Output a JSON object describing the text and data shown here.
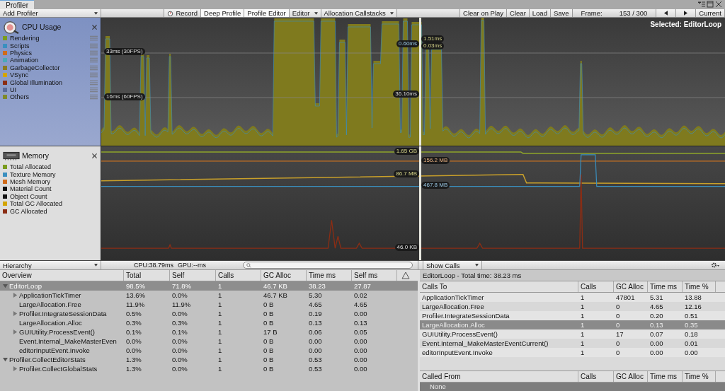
{
  "window": {
    "title": "Profiler"
  },
  "toolbar": {
    "add_profiler": "Add Profiler",
    "buttons": [
      {
        "label": "Record",
        "kind": "record"
      },
      {
        "label": "Deep Profile",
        "kind": "toggle"
      },
      {
        "label": "Profile Editor",
        "kind": "toggle"
      },
      {
        "label": "Editor",
        "kind": "dropdown"
      },
      {
        "label": "Allocation Callstacks",
        "kind": "dropdown"
      }
    ],
    "right_buttons": [
      "Clear on Play",
      "Clear",
      "Load",
      "Save"
    ],
    "frame_label": "Frame:",
    "frame_value": "153 / 300",
    "current": "Current"
  },
  "cpu": {
    "title": "CPU Usage",
    "legend": [
      {
        "name": "Rendering",
        "color": "#7a9c1e"
      },
      {
        "name": "Scripts",
        "color": "#3a8fbf"
      },
      {
        "name": "Physics",
        "color": "#d06b1a"
      },
      {
        "name": "Animation",
        "color": "#4aa8b8"
      },
      {
        "name": "GarbageCollector",
        "color": "#8b7a20"
      },
      {
        "name": "VSync",
        "color": "#d3a400"
      },
      {
        "name": "Global Illumination",
        "color": "#8b2d14"
      },
      {
        "name": "UI",
        "color": "#5a6a9a"
      },
      {
        "name": "Others",
        "color": "#7f8a2a"
      }
    ],
    "fps_lines": [
      "33ms (30FPS)",
      "16ms (60FPS)"
    ],
    "readings": [
      "1.51ms",
      "0.60ms",
      "0.03ms",
      "36.10ms"
    ],
    "selected": "Selected: EditorLoop"
  },
  "memory": {
    "title": "Memory",
    "legend": [
      {
        "name": "Total Allocated",
        "color": "#7a9c1e"
      },
      {
        "name": "Texture Memory",
        "color": "#3a8fbf"
      },
      {
        "name": "Mesh Memory",
        "color": "#d06b1a"
      },
      {
        "name": "Material Count",
        "color": "#111111"
      },
      {
        "name": "Object Count",
        "color": "#111111"
      },
      {
        "name": "Total GC Allocated",
        "color": "#d3a400"
      },
      {
        "name": "GC Allocated",
        "color": "#8b2d14"
      }
    ],
    "readings": [
      "1.65 GB",
      "156.2 MB",
      "86.7 MB",
      "467.8 MB",
      "46.0 KB"
    ]
  },
  "detail_bar": {
    "view": "Hierarchy",
    "cpu": "CPU:38.79ms",
    "gpu": "GPU:--ms",
    "calls_view": "Show Calls"
  },
  "overview": {
    "columns": [
      "Overview",
      "Total",
      "Self",
      "Calls",
      "GC Alloc",
      "Time ms",
      "Self ms"
    ],
    "rows": [
      {
        "cells": [
          "EditorLoop",
          "98.5%",
          "71.8%",
          "1",
          "46.7 KB",
          "38.23",
          "27.87"
        ],
        "expanded": true,
        "selected": true,
        "children": [
          {
            "cells": [
              "ApplicationTickTimer",
              "13.6%",
              "0.0%",
              "1",
              "46.7 KB",
              "5.30",
              "0.02"
            ],
            "expanded": false,
            "selected": false
          },
          {
            "cells": [
              "LargeAllocation.Free",
              "11.9%",
              "11.9%",
              "1",
              "0 B",
              "4.65",
              "4.65"
            ],
            "selected": false
          },
          {
            "cells": [
              "Profiler.IntegrateSessionData",
              "0.5%",
              "0.0%",
              "1",
              "0 B",
              "0.19",
              "0.00"
            ],
            "expanded": false,
            "selected": false
          },
          {
            "cells": [
              "LargeAllocation.Alloc",
              "0.3%",
              "0.3%",
              "1",
              "0 B",
              "0.13",
              "0.13"
            ],
            "selected": false
          },
          {
            "cells": [
              "GUIUtility.ProcessEvent()",
              "0.1%",
              "0.1%",
              "1",
              "17 B",
              "0.06",
              "0.05"
            ],
            "expanded": false,
            "selected": false
          },
          {
            "cells": [
              "Event.Internal_MakeMasterEven",
              "0.0%",
              "0.0%",
              "1",
              "0 B",
              "0.00",
              "0.00"
            ],
            "selected": false
          },
          {
            "cells": [
              "editorInputEvent.Invoke",
              "0.0%",
              "0.0%",
              "1",
              "0 B",
              "0.00",
              "0.00"
            ],
            "selected": false
          }
        ]
      },
      {
        "cells": [
          "Profiler.CollectEditorStats",
          "1.3%",
          "0.0%",
          "1",
          "0 B",
          "0.53",
          "0.00"
        ],
        "expanded": true,
        "selected": false,
        "children": [
          {
            "cells": [
              "Profiler.CollectGlobalStats",
              "1.3%",
              "0.0%",
              "1",
              "0 B",
              "0.53",
              "0.00"
            ],
            "expanded": false,
            "selected": false
          }
        ]
      }
    ]
  },
  "calls": {
    "title": "EditorLoop - Total time: 38.23 ms",
    "columns": [
      "Calls To",
      "Calls",
      "GC Alloc",
      "Time ms",
      "Time %"
    ],
    "rows": [
      {
        "cells": [
          "ApplicationTickTimer",
          "1",
          "47801",
          "5.31",
          "13.88"
        ],
        "selected": false
      },
      {
        "cells": [
          "LargeAllocation.Free",
          "1",
          "0",
          "4.65",
          "12.16"
        ],
        "selected": false
      },
      {
        "cells": [
          "Profiler.IntegrateSessionData",
          "1",
          "0",
          "0.20",
          "0.51"
        ],
        "selected": false
      },
      {
        "cells": [
          "LargeAllocation.Alloc",
          "1",
          "0",
          "0.13",
          "0.35"
        ],
        "selected": true
      },
      {
        "cells": [
          "GUIUtility.ProcessEvent()",
          "1",
          "17",
          "0.07",
          "0.18"
        ],
        "selected": false
      },
      {
        "cells": [
          "Event.Internal_MakeMasterEventCurrent()",
          "1",
          "0",
          "0.00",
          "0.01"
        ],
        "selected": false
      },
      {
        "cells": [
          "editorInputEvent.Invoke",
          "1",
          "0",
          "0.00",
          "0.00"
        ],
        "selected": false
      }
    ],
    "from_columns": [
      "Called From",
      "Calls",
      "GC Alloc",
      "Time ms",
      "Time %"
    ],
    "from_rows": [
      "None"
    ]
  }
}
